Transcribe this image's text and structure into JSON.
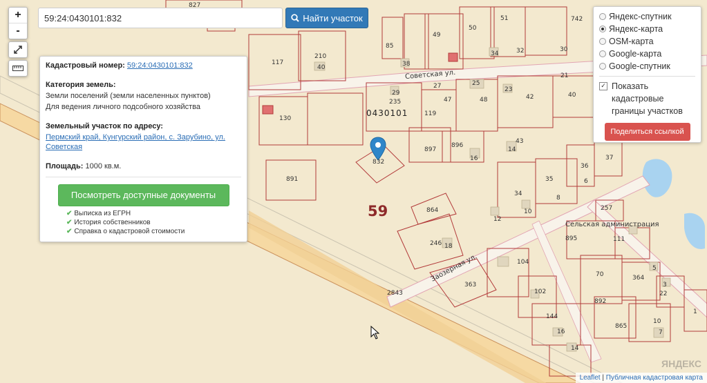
{
  "search": {
    "value": "59:24:0430101:832",
    "button_label": "Найти участок"
  },
  "zoom": {
    "in_label": "+",
    "out_label": "-"
  },
  "info_panel": {
    "cadastral_label": "Кадастровый номер:",
    "cadastral_value": "59:24:0430101:832",
    "category_label": "Категория земель:",
    "category_value": "Земли поселений (земли населенных пунктов)",
    "use_value": "Для ведения личного подсобного хозяйства",
    "address_label": "Земельный участок по адресу:",
    "address_value": "Пермский край, Кунгурский район, с. Зарубино, ул. Советская",
    "area_label": "Площадь:",
    "area_value": "1000 кв.м.",
    "docs_button": "Посмотреть доступные документы",
    "checks": [
      "Выписка из ЕГРН",
      "История собственников",
      "Справка о кадастровой стоимости"
    ]
  },
  "layers": {
    "options": [
      {
        "label": "Яндекс-спутник",
        "selected": false
      },
      {
        "label": "Яндекс-карта",
        "selected": true
      },
      {
        "label": "OSM-карта",
        "selected": false
      },
      {
        "label": "Google-карта",
        "selected": false
      },
      {
        "label": "Google-спутник",
        "selected": false
      }
    ],
    "show_boundaries_label": "Показать кадастровые границы участков",
    "show_boundaries_checked": true,
    "share_button": "Поделиться ссылкой"
  },
  "map": {
    "quarter_label": "0430101",
    "district_number": "59",
    "marker_parcel": "832",
    "streets": [
      "Советская ул.",
      "Заозерная ул."
    ],
    "poi": "Сельская администрация",
    "parcel_numbers": [
      "827",
      "117",
      "210",
      "40",
      "85",
      "38",
      "49",
      "50",
      "51",
      "742",
      "34",
      "32",
      "30",
      "130",
      "29",
      "235",
      "27",
      "47",
      "25",
      "48",
      "23",
      "42",
      "21",
      "40",
      "119",
      "897",
      "896",
      "16",
      "14",
      "43",
      "891",
      "864",
      "246",
      "18",
      "363",
      "2843",
      "104",
      "102",
      "144",
      "16",
      "14",
      "34",
      "10",
      "12",
      "35",
      "8",
      "36",
      "6",
      "37",
      "257",
      "895",
      "111",
      "70",
      "364",
      "892",
      "865",
      "10",
      "7",
      "22",
      "3",
      "1",
      "5"
    ]
  },
  "attribution": {
    "leaflet": "Leaflet",
    "sep": "|",
    "source": "Публичная кадастровая карта"
  },
  "colors": {
    "primary": "#3279b7",
    "success": "#5cb85c",
    "danger": "#d9534f",
    "parcel_border": "#b23a3a",
    "road": "#f4f0e4"
  }
}
